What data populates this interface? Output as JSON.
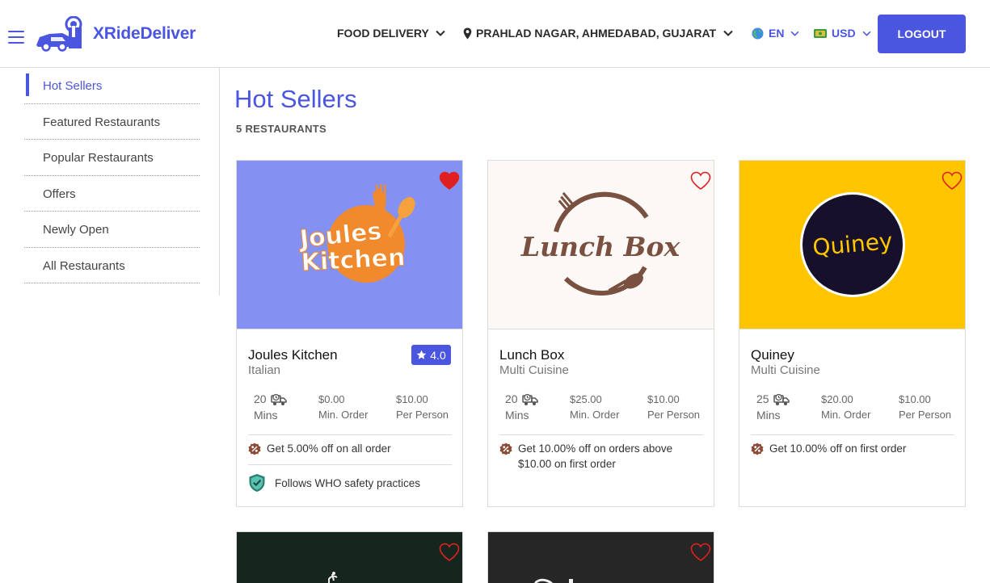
{
  "header": {
    "brand": "XRideDeliver",
    "service": "FOOD DELIVERY",
    "location": "PRAHLAD NAGAR, AHMEDABAD, GUJARAT ...",
    "language": "EN",
    "currency": "USD",
    "logout_label": "LOGOUT"
  },
  "sidebar": {
    "items": [
      {
        "label": "Hot Sellers"
      },
      {
        "label": "Featured Restaurants"
      },
      {
        "label": "Popular Restaurants"
      },
      {
        "label": "Offers"
      },
      {
        "label": "Newly Open"
      },
      {
        "label": "All Restaurants"
      }
    ]
  },
  "main": {
    "title": "Hot Sellers",
    "count": "5 RESTAURANTS",
    "restaurants": [
      {
        "name": "Joules Kitchen",
        "cuisine": "Italian",
        "logo_text_1": "Joules",
        "logo_text_2": "Kitchen",
        "rating": "4.0",
        "mins": "20",
        "mins_label": "Mins",
        "min_order": "$0.00",
        "min_order_label": "Min. Order",
        "per_person": "$10.00",
        "per_person_label": "Per Person",
        "offer": "Get 5.00% off on all order",
        "safety": "Follows WHO safety practices",
        "favorite": true,
        "bg_color": "#8591f2"
      },
      {
        "name": "Lunch Box",
        "cuisine": "Multi Cuisine",
        "logo_text_1": "Lunch Box",
        "mins": "20",
        "mins_label": "Mins",
        "min_order": "$25.00",
        "min_order_label": "Min. Order",
        "per_person": "$10.00",
        "per_person_label": "Per Person",
        "offer": "Get 10.00% off on orders above $10.00 on first order",
        "favorite": false,
        "bg_color": "#fbf8f6"
      },
      {
        "name": "Quiney",
        "cuisine": "Multi Cuisine",
        "logo_text_1": "Quiney",
        "mins": "25",
        "mins_label": "Mins",
        "min_order": "$20.00",
        "min_order_label": "Min. Order",
        "per_person": "$10.00",
        "per_person_label": "Per Person",
        "offer": "Get 10.00% off on first order",
        "favorite": false,
        "bg_color": "#ffc600"
      }
    ]
  },
  "colors": {
    "accent": "#4a55e0",
    "heart": "#e02020",
    "offer_badge": "#8a4a35"
  }
}
